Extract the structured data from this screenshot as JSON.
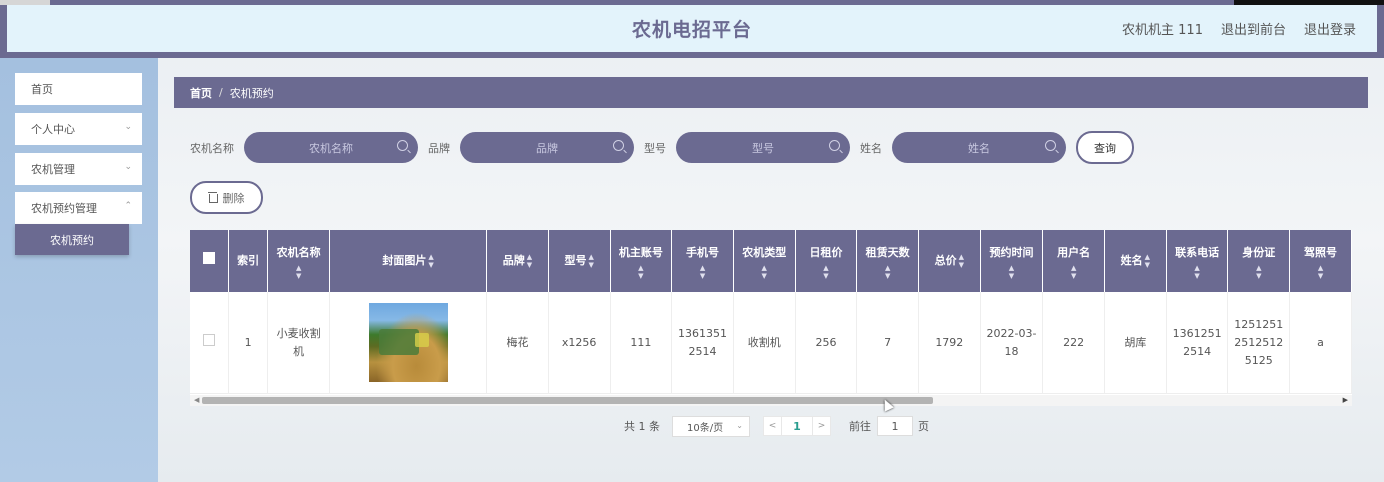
{
  "header": {
    "title": "农机电招平台",
    "user": "农机机主 111",
    "back_to_front": "退出到前台",
    "logout": "退出登录"
  },
  "sidebar": {
    "items": [
      {
        "label": "首页"
      },
      {
        "label": "个人中心"
      },
      {
        "label": "农机管理"
      },
      {
        "label": "农机预约管理"
      }
    ],
    "active_sub": "农机预约"
  },
  "breadcrumb": {
    "home": "首页",
    "sep": "/",
    "current": "农机预约"
  },
  "search": {
    "fields": [
      {
        "label": "农机名称",
        "placeholder": "农机名称"
      },
      {
        "label": "品牌",
        "placeholder": "品牌"
      },
      {
        "label": "型号",
        "placeholder": "型号"
      },
      {
        "label": "姓名",
        "placeholder": "姓名"
      }
    ],
    "query_label": "查询"
  },
  "actions": {
    "delete_label": "删除"
  },
  "table": {
    "headers": [
      "索引",
      "农机名称",
      "封面图片",
      "品牌",
      "型号",
      "机主账号",
      "手机号",
      "农机类型",
      "日租价",
      "租赁天数",
      "总价",
      "预约时间",
      "用户名",
      "姓名",
      "联系电话",
      "身份证",
      "驾照号"
    ],
    "rows": [
      {
        "index": "1",
        "name": "小麦收割机",
        "brand": "梅花",
        "model": "x1256",
        "owner": "111",
        "phone": "13613512514",
        "type": "收割机",
        "daily": "256",
        "days": "7",
        "total": "1792",
        "time": "2022-03-18",
        "username": "222",
        "realname": "胡库",
        "contact": "13612512514",
        "idcard": "125125125125125125",
        "license": "a"
      }
    ]
  },
  "pagination": {
    "total": "共 1 条",
    "page_size": "10条/页",
    "current": "1",
    "goto_label": "前往",
    "goto_value": "1",
    "page_suffix": "页"
  },
  "colors": {
    "accent": "#6b6a91",
    "header_bg": "#e3f3fb",
    "sidebar_bg": "#a4c0df"
  }
}
